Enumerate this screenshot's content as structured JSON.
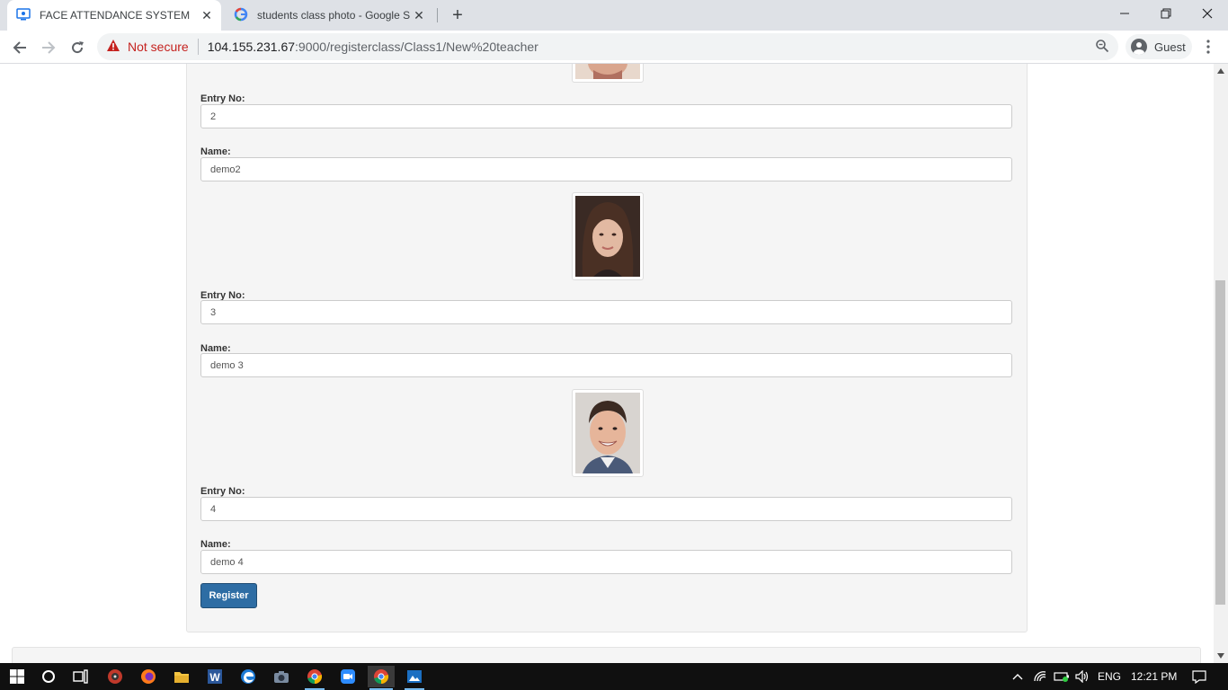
{
  "browser": {
    "tabs": [
      {
        "title": "FACE ATTENDANCE SYSTEM",
        "active": true
      },
      {
        "title": "students class photo - Google Se",
        "active": false
      }
    ],
    "security_label": "Not secure",
    "url_host": "104.155.231.67",
    "url_path": ":9000/registerclass/Class1/New%20teacher",
    "profile_label": "Guest"
  },
  "form": {
    "entry_label": "Entry No:",
    "name_label": "Name:",
    "students": [
      {
        "entry_no": "2",
        "name": "demo2"
      },
      {
        "entry_no": "3",
        "name": "demo 3"
      },
      {
        "entry_no": "4",
        "name": "demo 4"
      }
    ],
    "register_label": "Register"
  },
  "taskbar": {
    "language": "ENG",
    "time": "12:21 PM"
  },
  "colors": {
    "accent_button": "#2e6da4",
    "panel_bg": "#f5f5f5",
    "insecure_red": "#c5221f"
  }
}
